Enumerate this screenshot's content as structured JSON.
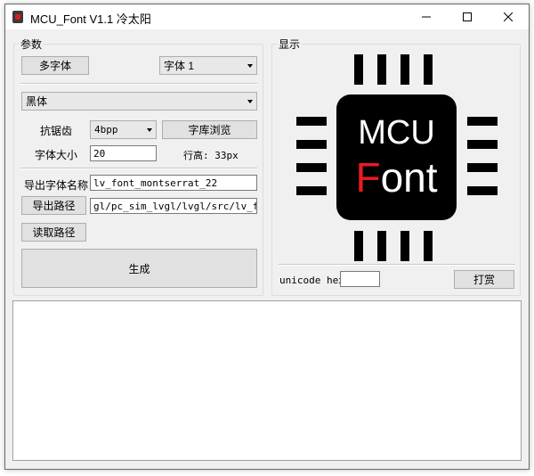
{
  "window": {
    "title": "MCU_Font V1.1  冷太阳",
    "minimize_icon": "minimize-icon",
    "maximize_icon": "maximize-icon",
    "close_icon": "close-icon"
  },
  "params": {
    "group_label": "参数",
    "multi_font_button": "多字体",
    "font_slot_select": "字体 1",
    "font_family_select": "黑体",
    "antialias_label": "抗锯齿",
    "antialias_select": "4bpp",
    "browse_font_button": "字库浏览",
    "font_size_label": "字体大小",
    "font_size_value": "20",
    "line_height_text": "行高: 33px",
    "export_name_label": "导出字体名称",
    "export_name_value": "lv_font_montserrat_22",
    "export_path_button": "导出路径",
    "export_path_value": "gl/pc_sim_lvgl/lvgl/src/lv_font",
    "read_path_button": "读取路径",
    "generate_button": "生成"
  },
  "display": {
    "group_label": "显示",
    "logo_line1": "MCU",
    "logo_line2_first": "F",
    "logo_line2_rest": "ont",
    "unicode_label": "unicode hex",
    "unicode_value": "",
    "reward_button": "打赏"
  },
  "colors": {
    "logo_red": "#e51c23",
    "logo_black": "#000000",
    "window_bg": "#f0f0f0"
  }
}
